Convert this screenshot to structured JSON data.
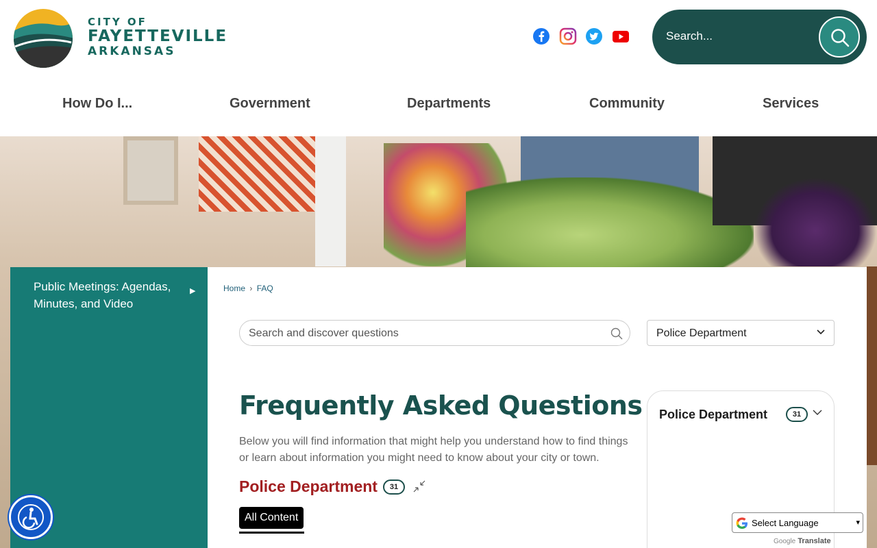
{
  "site": {
    "logo_line1": "CITY OF",
    "logo_line2": "FAYETTEVILLE",
    "logo_line3": "ARKANSAS"
  },
  "social": [
    "facebook-icon",
    "instagram-icon",
    "twitter-icon",
    "youtube-icon"
  ],
  "search": {
    "placeholder": "Search..."
  },
  "nav": {
    "items": [
      {
        "label": "How Do I..."
      },
      {
        "label": "Government"
      },
      {
        "label": "Departments"
      },
      {
        "label": "Community"
      },
      {
        "label": "Services"
      }
    ]
  },
  "sidebar": {
    "items": [
      {
        "label": "Public Meetings: Agendas, Minutes, and Video"
      }
    ]
  },
  "breadcrumb": {
    "home": "Home",
    "sep": "›",
    "current": "FAQ"
  },
  "faq_search": {
    "placeholder": "Search and discover questions"
  },
  "dept_select": {
    "value": "Police Department"
  },
  "page": {
    "title": "Frequently Asked Questions",
    "intro": "Below you will find information that might help you understand how to find things or learn about information you might need to know about your city or town."
  },
  "category": {
    "title": "Police Department",
    "count": "31"
  },
  "filter": {
    "label": "All Content"
  },
  "side_panel": {
    "title": "Police Department",
    "count": "31"
  },
  "translate": {
    "label": "Select Language",
    "caret": "▾",
    "powered_google": "Google",
    "powered_translate": "Translate"
  },
  "colors": {
    "brand_teal": "#177b75",
    "dark_teal": "#1c4f4b",
    "title_color": "#1a524e",
    "category_red": "#a21f21"
  }
}
